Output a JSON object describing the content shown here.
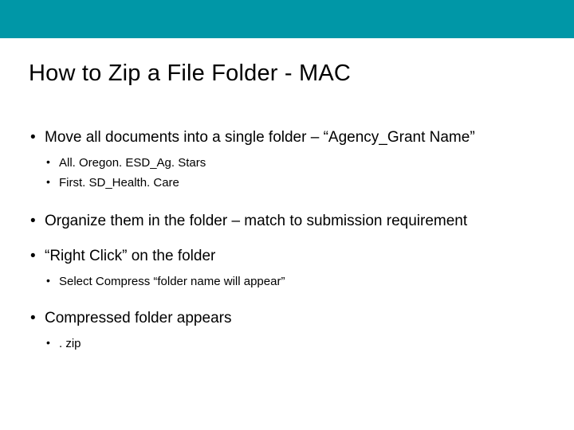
{
  "title": "How to Zip a File Folder - MAC",
  "bullets": [
    {
      "text": "Move all documents into a single folder – “Agency_Grant Name”",
      "sub": [
        "All. Oregon. ESD_Ag. Stars",
        "First. SD_Health. Care"
      ]
    },
    {
      "text": "Organize them in the folder – match to submission requirement",
      "sub": []
    },
    {
      "text": "“Right Click” on the folder",
      "sub": [
        "Select Compress “folder name will appear”"
      ]
    },
    {
      "text": "Compressed folder appears",
      "sub": [
        ". zip"
      ]
    }
  ]
}
